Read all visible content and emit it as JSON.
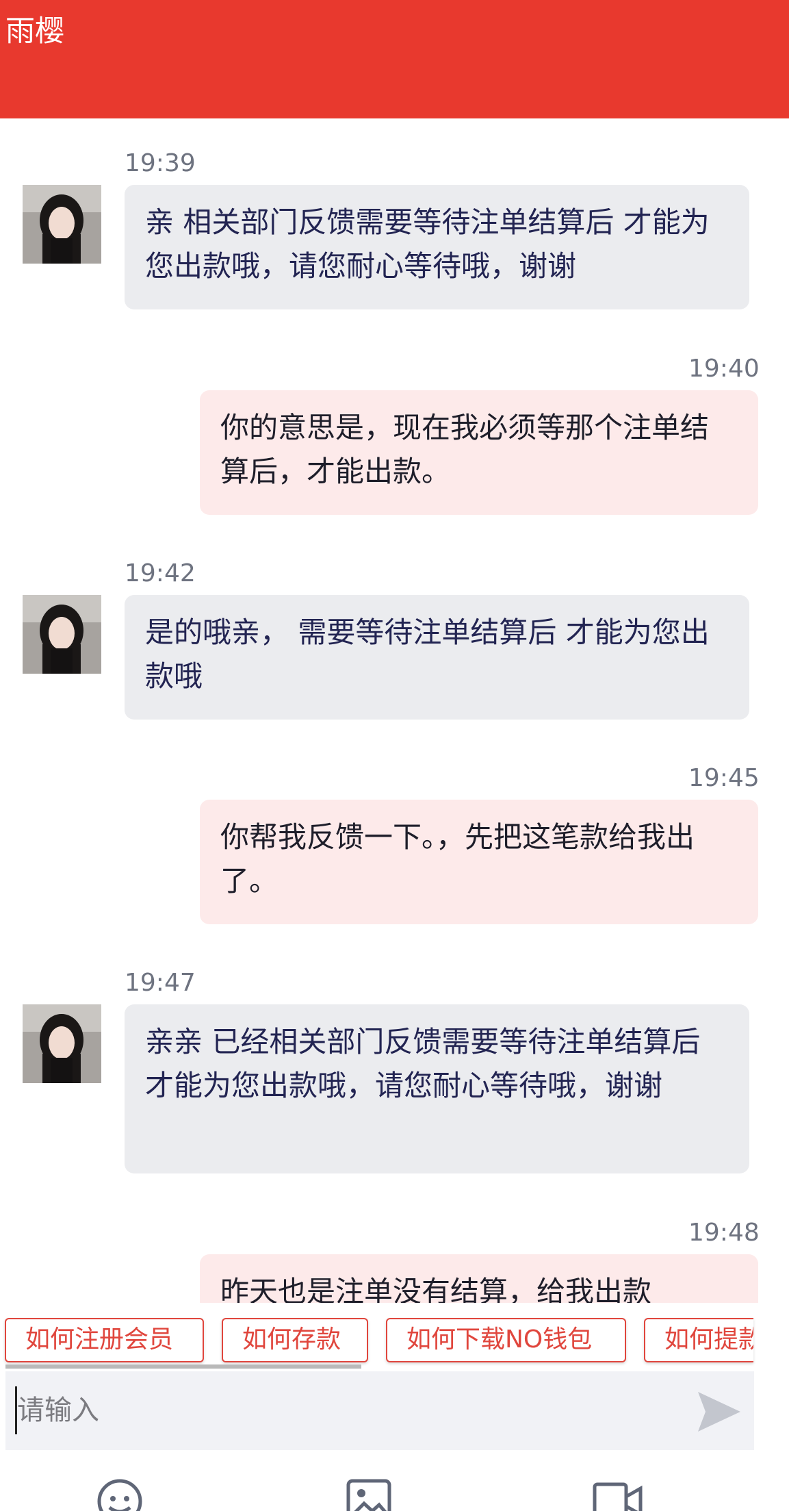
{
  "header": {
    "title": "雨樱"
  },
  "messages": [
    {
      "time": "19:39",
      "text": "亲 相关部门反馈需要等待注单结算后 才能为您出款哦，请您耐心等待哦，谢谢"
    },
    {
      "time": "19:40",
      "text": "你的意思是，现在我必须等那个注单结算后，才能出款。"
    },
    {
      "time": "19:42",
      "text": "是的哦亲， 需要等待注单结算后 才能为您出款哦"
    },
    {
      "time": "19:45",
      "text": "你帮我反馈一下。，先把这笔款给我出了。"
    },
    {
      "time": "19:47",
      "text": "亲亲 已经相关部门反馈需要等待注单结算后 才能为您出款哦，请您耐心等待哦，谢谢"
    },
    {
      "time": "19:48",
      "text": "昨天也是注单没有结算，给我出款"
    }
  ],
  "quick_replies": [
    "如何注册会员",
    "如何存款",
    "如何下载NO钱包",
    "如何提款"
  ],
  "input": {
    "placeholder": "请输入",
    "value": ""
  },
  "icons": {
    "avatar": "avatar-icon",
    "send": "send-icon",
    "emoji": "emoji-icon",
    "image": "image-icon",
    "video": "video-icon"
  },
  "colors": {
    "header": "#e8392e",
    "incoming_bubble": "#ebecef",
    "outgoing_bubble": "#fdeaea",
    "chip_border": "#e0463d",
    "input_bg": "#f1f2f6"
  }
}
